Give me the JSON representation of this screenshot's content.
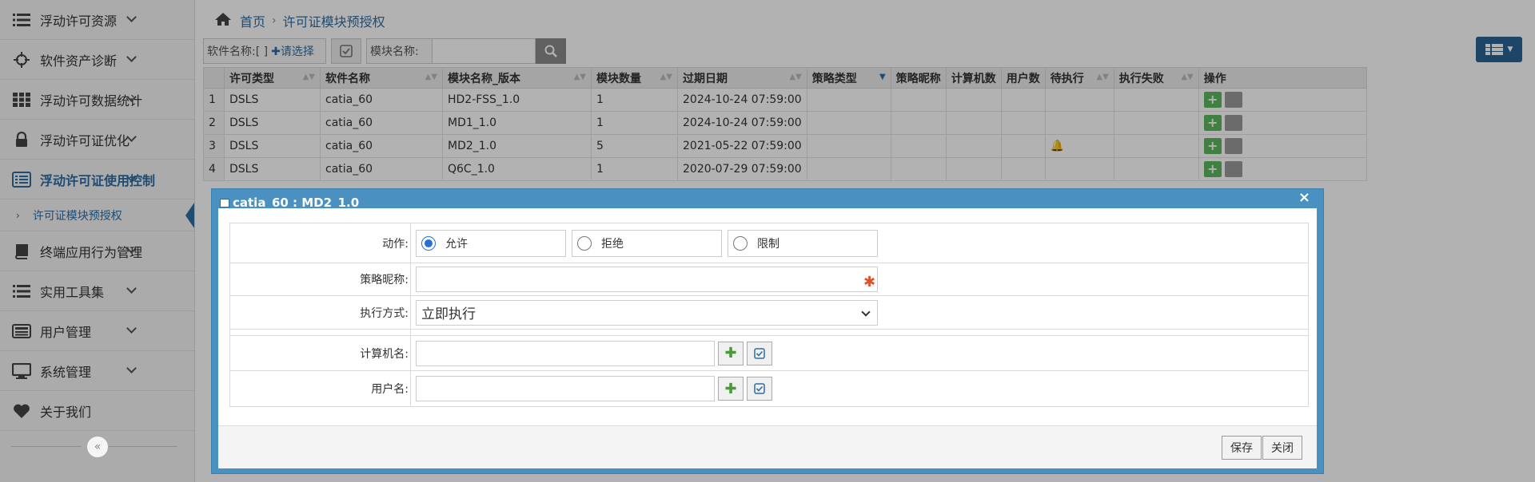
{
  "sidebar": {
    "items": [
      {
        "label": "浮动许可资源",
        "icon": "list-icon"
      },
      {
        "label": "软件资产诊断",
        "icon": "crosshair-icon"
      },
      {
        "label": "浮动许可数据统计",
        "icon": "grid-icon"
      },
      {
        "label": "浮动许可证优化",
        "icon": "lock-icon"
      },
      {
        "label": "浮动许可证使用控制",
        "icon": "table-icon"
      },
      {
        "label": "终端应用行为管理",
        "icon": "book-icon"
      },
      {
        "label": "实用工具集",
        "icon": "list-icon"
      },
      {
        "label": "用户管理",
        "icon": "card-icon"
      },
      {
        "label": "系统管理",
        "icon": "monitor-icon"
      },
      {
        "label": "关于我们",
        "icon": "heart-icon"
      }
    ],
    "subitem": "许可证模块预授权",
    "collapse_symbol": "«"
  },
  "breadcrumb": {
    "home": "首页",
    "current": "许可证模块预授权"
  },
  "toolbar": {
    "software_label": "软件名称:[ ]",
    "choose_label": "✚请选择",
    "module_label": "模块名称:"
  },
  "table": {
    "columns": [
      "许可类型",
      "软件名称",
      "模块名称_版本",
      "模块数量",
      "过期日期",
      "策略类型",
      "策略昵称",
      "计算机数",
      "用户数",
      "待执行",
      "执行失败",
      "操作"
    ],
    "rows": [
      {
        "no": "1",
        "type": "DSLS",
        "software": "catia_60",
        "module": "HD2-FSS_1.0",
        "qty": "1",
        "expire": "2024-10-24 07:59:00"
      },
      {
        "no": "2",
        "type": "DSLS",
        "software": "catia_60",
        "module": "MD1_1.0",
        "qty": "1",
        "expire": "2024-10-24 07:59:00"
      },
      {
        "no": "3",
        "type": "DSLS",
        "software": "catia_60",
        "module": "MD2_1.0",
        "qty": "5",
        "expire": "2021-05-22 07:59:00"
      },
      {
        "no": "4",
        "type": "DSLS",
        "software": "catia_60",
        "module": "Q6C_1.0",
        "qty": "1",
        "expire": "2020-07-29 07:59:00"
      }
    ]
  },
  "dialog": {
    "title": "catia_60 : MD2_1.0",
    "close": "×",
    "action_label": "动作:",
    "actions": [
      "允许",
      "拒绝",
      "限制"
    ],
    "selected_action": "允许",
    "nickname_label": "策略昵称:",
    "nickname_value": "",
    "exec_label": "执行方式:",
    "exec_value": "立即执行",
    "computer_label": "计算机名:",
    "user_label": "用户名:",
    "save": "保存",
    "close_btn": "关闭"
  },
  "colors": {
    "accent": "#2e6da4",
    "dialog_header": "#4a90c0",
    "required": "#e0502f"
  }
}
